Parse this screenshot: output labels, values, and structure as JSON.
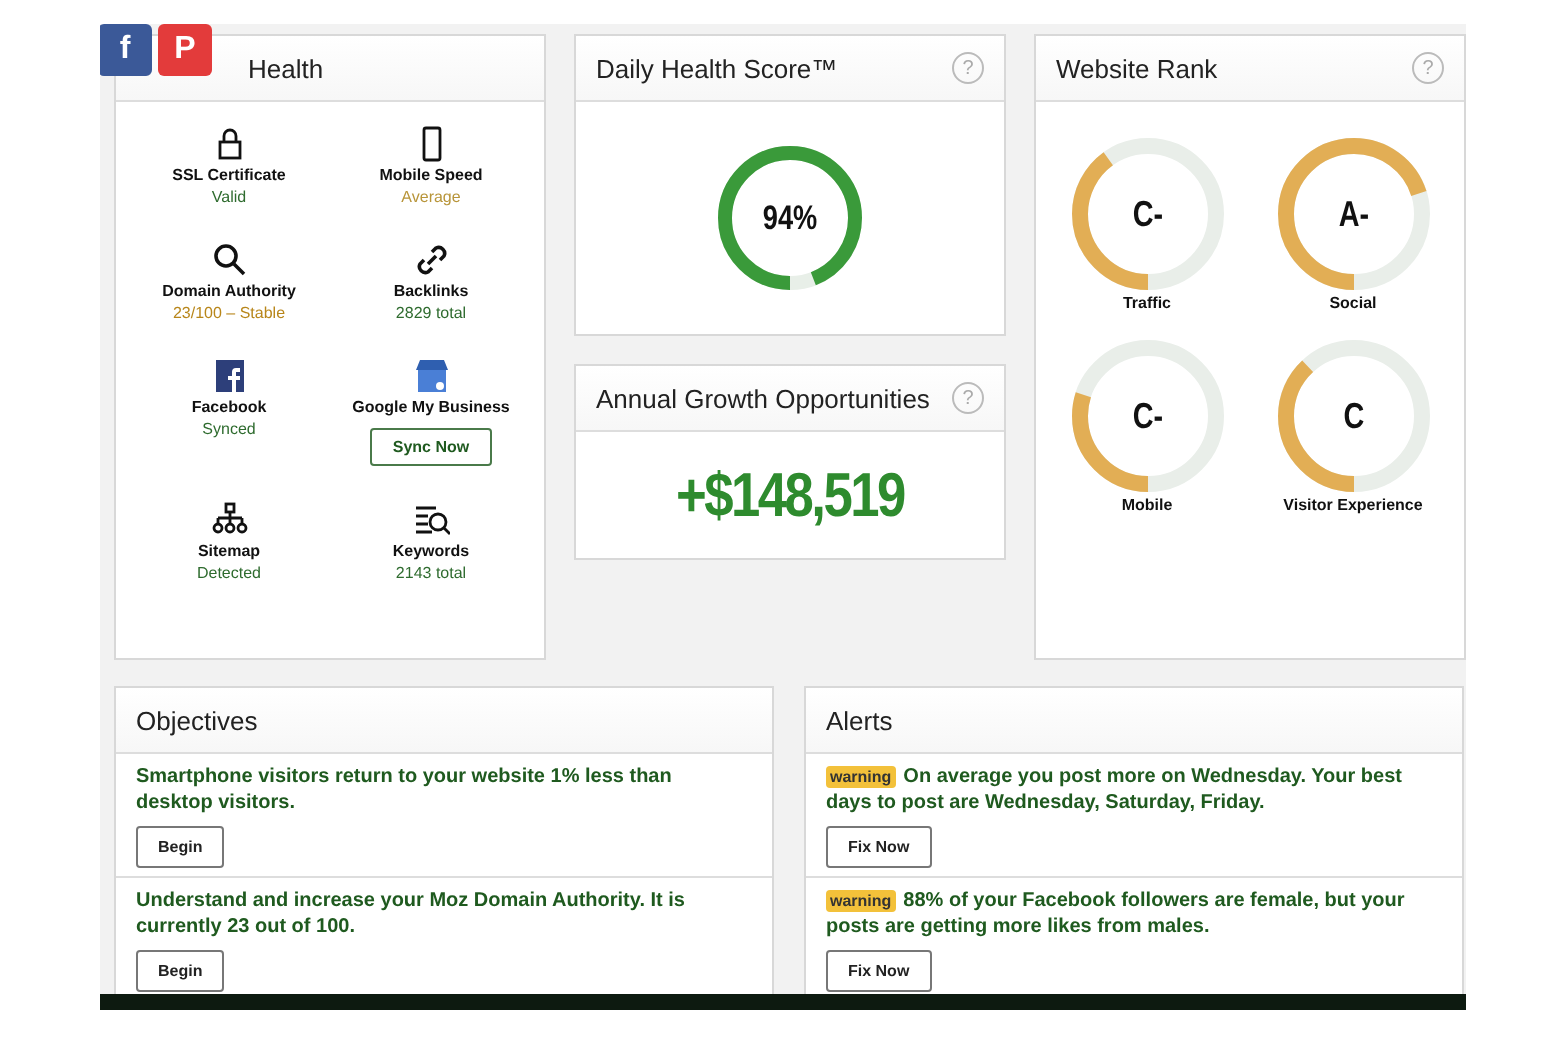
{
  "share_buttons": [
    {
      "kind": "facebook",
      "label": "f"
    },
    {
      "kind": "pinterest",
      "label": "P"
    }
  ],
  "website_health": {
    "title": "Health",
    "items": [
      {
        "label": "SSL Certificate",
        "status": "Valid",
        "color": "#2e6b2e"
      },
      {
        "label": "Mobile Speed",
        "status": "Average",
        "color": "#b8953a"
      },
      {
        "label": "Domain Authority",
        "status": "23/100 – Stable",
        "color": "#b8861a"
      },
      {
        "label": "Backlinks",
        "status": "2829 total",
        "color": "#2e6b2e"
      },
      {
        "label": "Facebook",
        "status": "Synced",
        "color": "#2e6b2e"
      },
      {
        "label": "Google My Business",
        "button": "Sync Now"
      },
      {
        "label": "Sitemap",
        "status": "Detected",
        "color": "#2e6b2e"
      },
      {
        "label": "Keywords",
        "status": "2143 total",
        "color": "#2e6b2e"
      }
    ]
  },
  "daily_health_score": {
    "title": "Daily Health Score™",
    "help": "?",
    "score": "94%",
    "level": 0.94
  },
  "annual_growth": {
    "title": "Annual Growth Opportunities",
    "help": "?",
    "value": "+$148,519"
  },
  "website_rank": {
    "title": "Website Rank",
    "help": "?",
    "ranks": [
      {
        "grade": "C-",
        "label": "Traffic",
        "level": 0.4
      },
      {
        "grade": "A-",
        "label": "Social",
        "level": 0.7
      },
      {
        "grade": "C-",
        "label": "Mobile",
        "level": 0.3
      },
      {
        "grade": "C",
        "label": "Visitor Experience",
        "level": 0.38
      }
    ]
  },
  "objectives": {
    "title": "Objectives",
    "items": [
      {
        "text": "Smartphone visitors return to your website 1% less than desktop visitors.",
        "button": "Begin"
      },
      {
        "text": "Understand and increase your Moz Domain Authority. It is currently 23 out of 100.",
        "button": "Begin"
      }
    ]
  },
  "alerts": {
    "title": "Alerts",
    "items": [
      {
        "badge": "warning",
        "text": "On average you post more on Wednesday. Your best days to post are Wednesday, Saturday, Friday.",
        "button": "Fix Now"
      },
      {
        "badge": "warning",
        "text": "88% of your Facebook followers are female, but your posts are getting more likes from males.",
        "button": "Fix Now"
      }
    ]
  }
}
